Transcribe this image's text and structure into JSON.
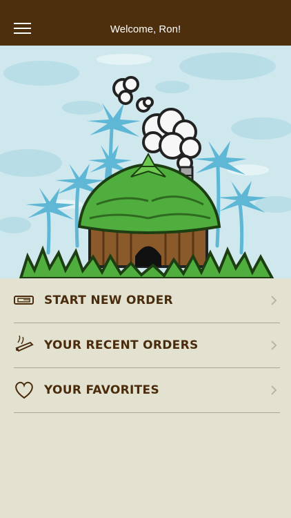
{
  "header": {
    "title": "Welcome, Ron!",
    "menu_icon": "hamburger-menu-icon"
  },
  "colors": {
    "topbar": "#4d2f0d",
    "background": "#e3e2d1",
    "label": "#4a2c0c",
    "divider": "#a8a692"
  },
  "menu": {
    "items": [
      {
        "label": "START NEW ORDER",
        "icon": "rolling-tray-icon"
      },
      {
        "label": "YOUR RECENT ORDERS",
        "icon": "joint-icon"
      },
      {
        "label": "YOUR FAVORITES",
        "icon": "heart-icon"
      }
    ]
  }
}
